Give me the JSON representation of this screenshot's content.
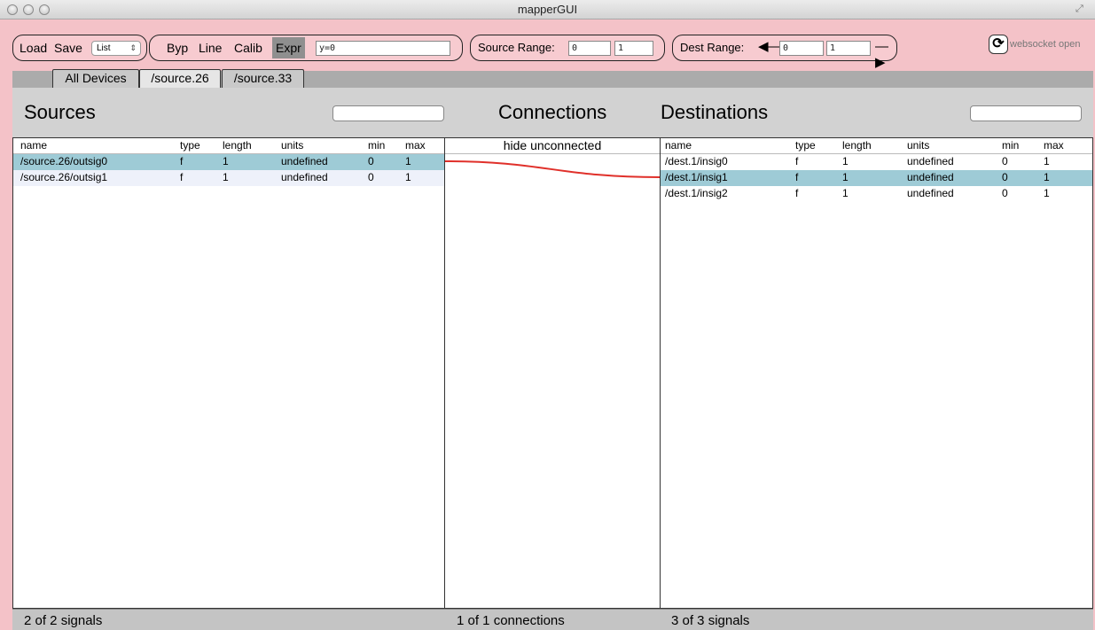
{
  "window": {
    "title": "mapperGUI"
  },
  "toolbar": {
    "load_label": "Load",
    "save_label": "Save",
    "view_select": "List",
    "modes": [
      "Byp",
      "Line",
      "Calib",
      "Expr"
    ],
    "active_mode": "Expr",
    "expression": "y=0",
    "source_range_label": "Source Range:",
    "source_min": "0",
    "source_max": "1",
    "dest_range_label": "Dest Range:",
    "dest_min": "0",
    "dest_max": "1",
    "websocket_status": "websocket open"
  },
  "tabs": [
    "All Devices",
    "/source.26",
    "/source.33"
  ],
  "selected_tab": "/source.26",
  "sources": {
    "title": "Sources",
    "columns": [
      "name",
      "type",
      "length",
      "units",
      "min",
      "max"
    ],
    "rows": [
      [
        "/source.26/outsig0",
        "f",
        "1",
        "undefined",
        "0",
        "1"
      ],
      [
        "/source.26/outsig1",
        "f",
        "1",
        "undefined",
        "0",
        "1"
      ]
    ],
    "footer": "2 of 2 signals"
  },
  "connections": {
    "title": "Connections",
    "header": "hide unconnected",
    "footer": "1 of 1 connections",
    "line_color": "#e0302a"
  },
  "destinations": {
    "title": "Destinations",
    "columns": [
      "name",
      "type",
      "length",
      "units",
      "min",
      "max"
    ],
    "rows": [
      [
        "/dest.1/insig0",
        "f",
        "1",
        "undefined",
        "0",
        "1"
      ],
      [
        "/dest.1/insig1",
        "f",
        "1",
        "undefined",
        "0",
        "1"
      ],
      [
        "/dest.1/insig2",
        "f",
        "1",
        "undefined",
        "0",
        "1"
      ]
    ],
    "footer": "3 of 3 signals"
  },
  "colors": {
    "background": "#f4c2c8",
    "selected_row": "#9ecbd6",
    "alt_row": "#eef1fa"
  }
}
